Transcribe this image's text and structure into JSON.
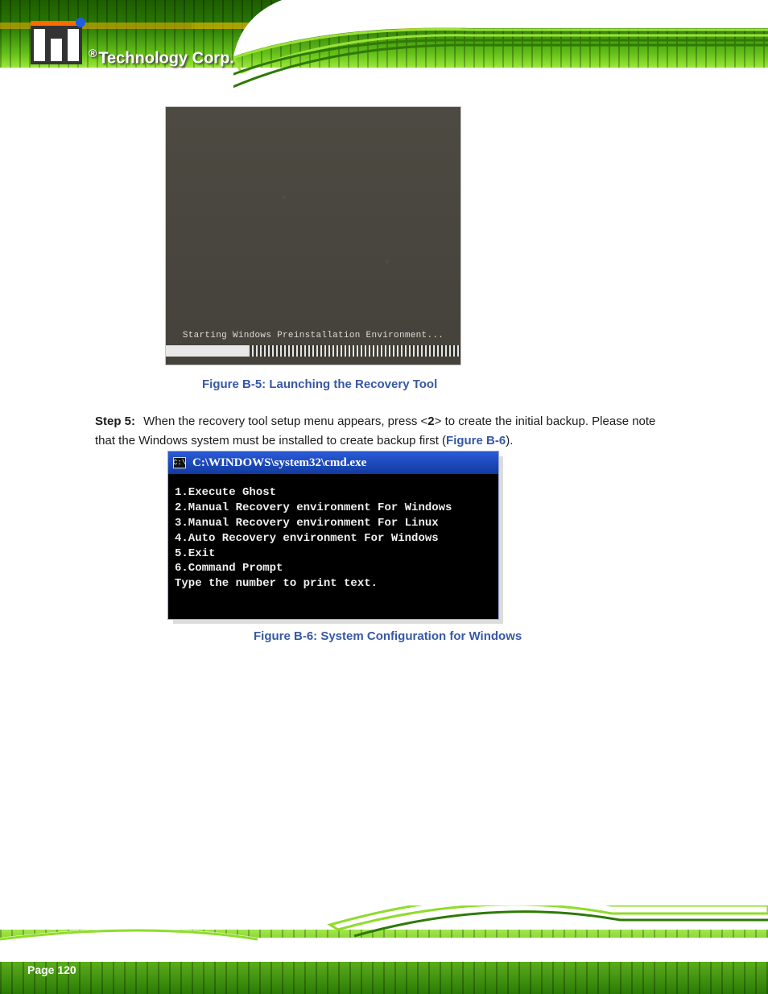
{
  "brand": {
    "reg": "®",
    "name": "Technology Corp."
  },
  "fig1": {
    "boot_caption": "Starting Windows Preinstallation Environment...",
    "label": "Figure B-5: Launching the Recovery Tool"
  },
  "step": {
    "num_label": "Step 5:",
    "text_before": " When the recovery tool setup menu appears, press <",
    "key": "2",
    "text_mid": "> to create the initial backup. Please note that the Windows system must be installed to create backup first (",
    "ref": "Figure B-6",
    "text_after": ")."
  },
  "cmd": {
    "icon_text": "C:\\",
    "title": "C:\\WINDOWS\\system32\\cmd.exe",
    "lines": [
      "1.Execute Ghost",
      "2.Manual Recovery environment For Windows",
      "3.Manual Recovery environment For Linux",
      "4.Auto Recovery environment For Windows",
      "5.Exit",
      "6.Command Prompt",
      "Type the number to print text."
    ]
  },
  "fig2": {
    "label": "Figure B-6: System Configuration for Windows"
  },
  "page_number": "Page 120"
}
